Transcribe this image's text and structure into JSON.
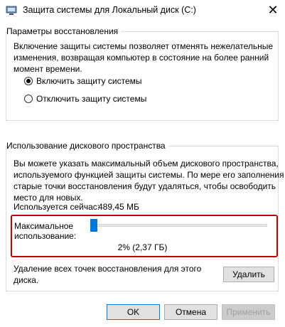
{
  "window": {
    "title": "Защита системы для Локальный диск (C:)",
    "close_glyph": "✕",
    "icon": "system-protection-icon"
  },
  "restore_settings": {
    "legend": "Параметры восстановления",
    "description_line1": "Включение защиты системы позволяет отменять нежелательные",
    "description_line2": "изменения, возвращая компьютер в состояние на более ранний",
    "description_line3": "момент времени.",
    "options": [
      {
        "label": "Включить защиту системы",
        "selected": true
      },
      {
        "label": "Отключить защиту системы",
        "selected": false
      }
    ]
  },
  "disk_usage": {
    "legend": "Использование дискового пространства",
    "description_line1": "Вы можете указать максимальный объем дискового пространства,",
    "description_line2": "используемого функцией защиты системы. По мере его заполнения",
    "description_line3": "старые точки восстановления будут удаляться, чтобы освободить",
    "description_line4": "место для новых.",
    "current_usage_label": "Используется сейчас:",
    "current_usage_value": "489,45 МБ",
    "max_usage_label_line1": "Максимальное",
    "max_usage_label_line2": "использование:",
    "slider_fraction": 0.02,
    "slider_value_text": "2% (2,37 ГБ)",
    "delete_text_line1": "Удаление всех точек восстановления для этого",
    "delete_text_line2": "диска.",
    "delete_button": "Удалить"
  },
  "footer": {
    "ok": "OK",
    "cancel": "Отмена",
    "apply": "Применить"
  },
  "colors": {
    "accent": "#0078d7",
    "highlight_frame": "#c00000"
  }
}
